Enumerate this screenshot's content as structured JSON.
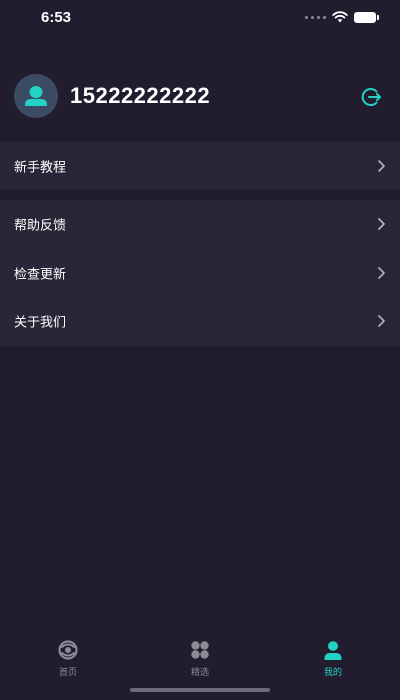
{
  "status_bar": {
    "time": "6:53"
  },
  "profile": {
    "phone": "15222222222"
  },
  "menu": {
    "group1": [
      {
        "label": "新手教程"
      }
    ],
    "group2": [
      {
        "label": "帮助反馈"
      },
      {
        "label": "检查更新"
      },
      {
        "label": "关于我们"
      }
    ]
  },
  "tab_bar": {
    "tabs": [
      {
        "label": "首页",
        "icon": "home-swirl-icon"
      },
      {
        "label": "精选",
        "icon": "grid-icon"
      },
      {
        "label": "我的",
        "icon": "user-icon",
        "active": true
      }
    ]
  },
  "colors": {
    "background": "#211d2e",
    "menu_background": "#2a2638",
    "accent": "#22d3c5",
    "muted": "#8c8a95",
    "avatar_bg": "#3a4b63"
  }
}
